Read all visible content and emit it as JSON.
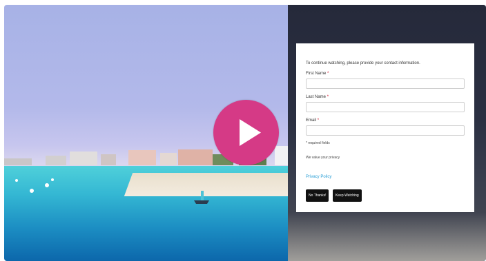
{
  "video": {
    "play_icon": "play-icon",
    "accent_color": "#d53a86"
  },
  "form": {
    "intro": "To continue watching, please provide your contact information.",
    "first_name_label": "First Name",
    "last_name_label": "Last Name",
    "email_label": "Email",
    "required_marker": "*",
    "first_name_value": "",
    "last_name_value": "",
    "email_value": "",
    "required_note": "* required fields",
    "privacy_note": "We value your privacy",
    "privacy_link": "Privacy Policy",
    "no_thanks_label": "No Thanks!",
    "keep_watching_label": "Keep Watching"
  }
}
